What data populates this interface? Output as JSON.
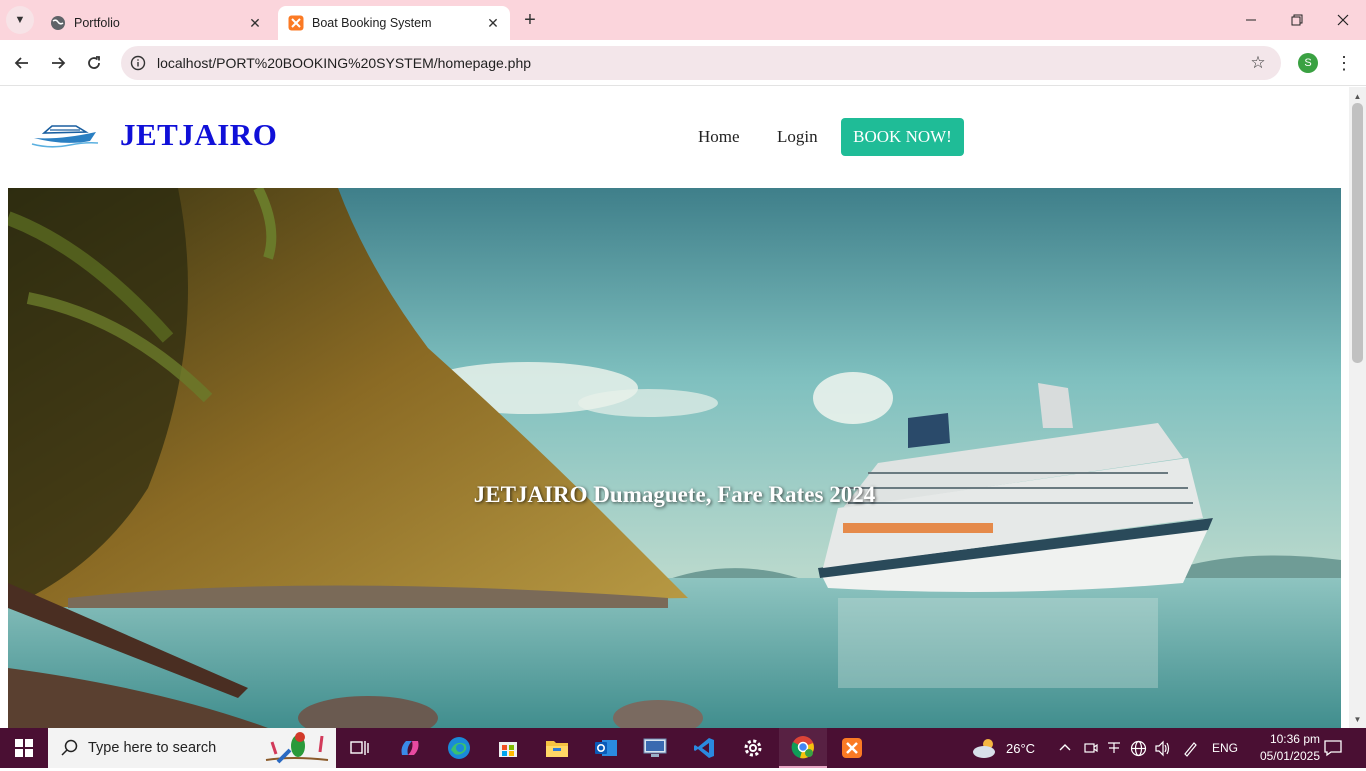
{
  "browser": {
    "tabs": [
      {
        "title": "Portfolio",
        "icon": "globe-icon",
        "active": false
      },
      {
        "title": "Boat Booking System",
        "icon": "xampp-icon",
        "active": true
      }
    ],
    "url": "localhost/PORT%20BOOKING%20SYSTEM/homepage.php",
    "profile_initial": "S"
  },
  "site": {
    "brand": "JETJAIRO",
    "nav": {
      "home": "Home",
      "login": "Login",
      "book_now": "BOOK NOW!"
    },
    "hero_title": "JETJAIRO Dumaguete, Fare Rates 2024"
  },
  "colors": {
    "brand": "#1010d8",
    "book_button": "#1fbc97",
    "tab_bar": "#fbd5dc",
    "taskbar": "#4a0f33"
  },
  "taskbar": {
    "search_placeholder": "Type here to search",
    "apps": [
      "task-view-icon",
      "copilot-icon",
      "edge-icon",
      "store-icon",
      "file-explorer-icon",
      "outlook-icon",
      "remote-desktop-icon",
      "vscode-icon",
      "settings-icon",
      "chrome-icon",
      "xampp-icon"
    ],
    "weather": "26°C",
    "language": "ENG",
    "time": "10:36 pm",
    "date": "05/01/2025"
  }
}
